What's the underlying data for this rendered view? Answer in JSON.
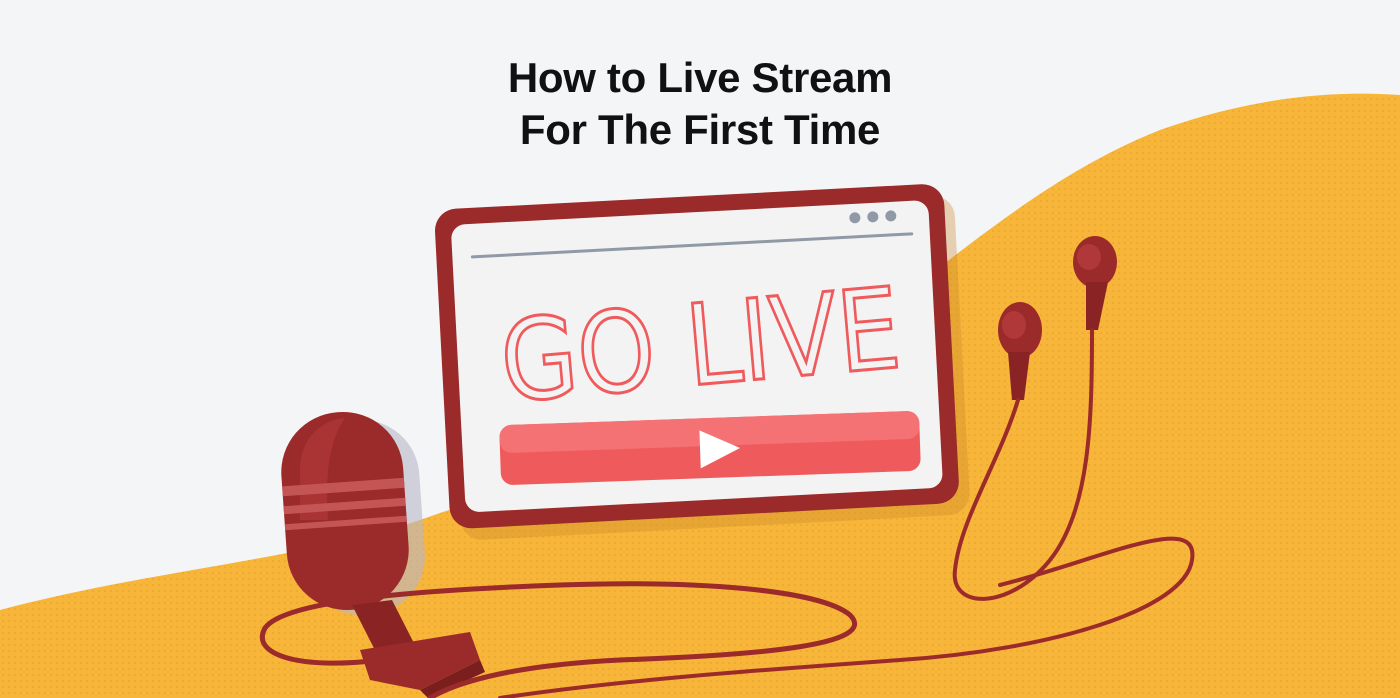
{
  "title": {
    "line1": "How to Live Stream",
    "line2": "For The First Time"
  },
  "screen": {
    "text": "GO LIVE"
  },
  "colors": {
    "background": "#f4f5f7",
    "wave": "#f7b53a",
    "device_frame": "#9b2a2a",
    "accent_red": "#ef5a5c",
    "title_text": "#111111"
  },
  "icons": [
    "play-icon",
    "window-dots-icon",
    "microphone-icon",
    "earbuds-icon"
  ]
}
